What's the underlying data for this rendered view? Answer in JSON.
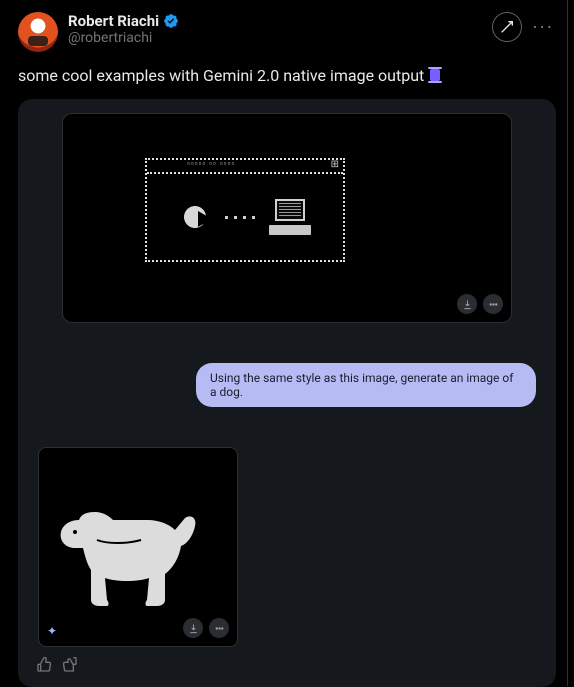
{
  "author": {
    "display_name": "Robert Riachi",
    "handle": "@robertriachi"
  },
  "tweet_text": "some cool examples with Gemini 2.0 native image output",
  "conversation": {
    "user_prompt": "Using the same style as this image, generate an image of a dog."
  },
  "icons": {
    "verified": "verified-badge",
    "grok": "grok",
    "more": "more",
    "download": "download",
    "options": "options",
    "sparkle": "sparkle",
    "thumbs_up": "thumbs-up",
    "thumbs_down": "thumbs-down"
  }
}
